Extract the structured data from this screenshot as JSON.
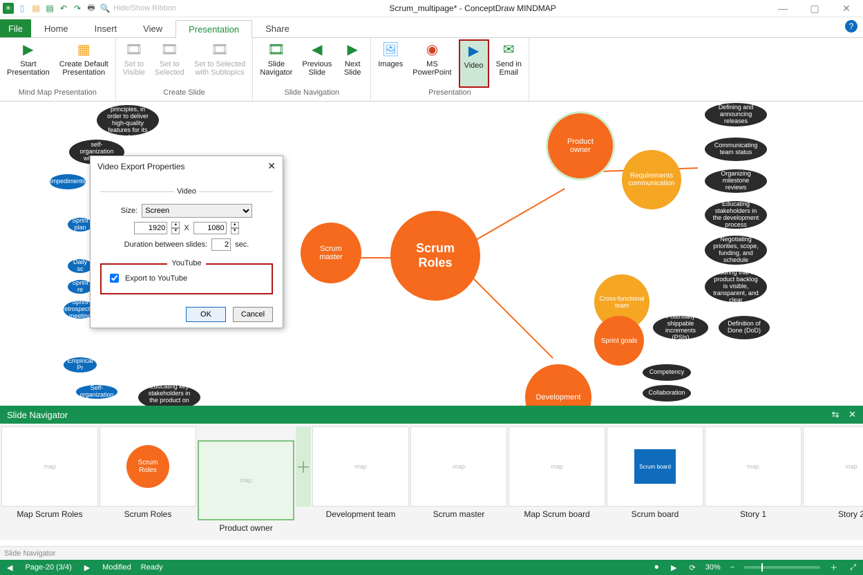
{
  "window": {
    "title": "Scrum_multipage* - ConceptDraw MINDMAP",
    "hide_ribbon": "Hide/Show Ribbon"
  },
  "tabs": {
    "file": "File",
    "home": "Home",
    "insert": "Insert",
    "view": "View",
    "presentation": "Presentation",
    "share": "Share"
  },
  "ribbon": {
    "group_mindmap": "Mind Map Presentation",
    "start_presentation": "Start\nPresentation",
    "create_default": "Create Default\nPresentation",
    "group_create": "Create Slide",
    "set_visible": "Set to\nVisible",
    "set_selected": "Set to\nSelected",
    "set_sel_sub": "Set to Selected\nwith Subtopics",
    "group_nav": "Slide Navigation",
    "slide_nav": "Slide\nNavigator",
    "prev_slide": "Previous\nSlide",
    "next_slide": "Next\nSlide",
    "images": "Images",
    "group_pres": "Presentation",
    "ms_ppt": "MS\nPowerPoint",
    "video": "Video",
    "send_email": "Send in\nEmail"
  },
  "canvas": {
    "center": "Scrum\nRoles",
    "scrum_master": "Scrum\nmaster",
    "product_owner": "Product\nowner",
    "req_comm": "Requirements\ncommunication",
    "cross_team": "Cross-functional\nteam",
    "sprint_goals": "Sprint goals",
    "development": "Development",
    "pills": {
      "p1": "Defining and announcing releases",
      "p2": "Communicating team status",
      "p3": "Organizing milestone reviews",
      "p4": "Educating stakeholders in the development process",
      "p5": "Negotiating priorities, scope, funding, and schedule",
      "p6": "Ensuring that the product backlog is visible, transparent, and clear",
      "p7": "Potentially shippable increments (PSIs)",
      "p8": "Definition of Done (DoD)",
      "p9": "Competency",
      "p10": "Collaboration",
      "l1": "Promoting self-organization within the team",
      "l2": "Impediments",
      "l3": "Sprint plan",
      "l4": "Daily sc",
      "l5": "Sprint re",
      "l6": "Sprint retrospective meeting",
      "l7": "Empirical Pr",
      "l8": "Self-organization",
      "l9": "Educating key stakeholders in the product on scrum",
      "top": "the scrum principles, in order to deliver high-quality features for its product"
    }
  },
  "dialog": {
    "title": "Video Export Properties",
    "video_legend": "Video",
    "size_label": "Size:",
    "size_value": "Screen",
    "width": "1920",
    "height": "1080",
    "x_sep": "X",
    "duration_label": "Duration between slides:",
    "duration": "2",
    "sec": "sec.",
    "yt_legend": "YouTube",
    "export_yt": "Export to YouTube",
    "ok": "OK",
    "cancel": "Cancel"
  },
  "slidenav": {
    "title": "Slide Navigator",
    "slides": [
      "Map Scrum Roles",
      "Scrum Roles",
      "Product owner",
      "Development team",
      "Scrum master",
      "Map Scrum board",
      "Scrum board",
      "Story 1",
      "Story 2"
    ],
    "bottom_label": "Slide Navigator"
  },
  "status": {
    "page": "Page-20 (3/4)",
    "modified": "Modified",
    "ready": "Ready",
    "zoom": "30%"
  },
  "chart_data": {
    "type": "mindmap",
    "central_node": "Scrum Roles",
    "branches": [
      {
        "name": "Scrum master",
        "children": [
          "Promoting self-organization within the team",
          "Impediments",
          "Sprint planning",
          "Daily scrum",
          "Sprint review",
          "Sprint retrospective meeting",
          "Empirical Process",
          "Self-organization",
          "Educating key stakeholders in the product on scrum",
          "the scrum principles, in order to deliver high-quality features for its product"
        ]
      },
      {
        "name": "Product owner",
        "children": [
          {
            "name": "Requirements communication",
            "children": [
              "Defining and announcing releases",
              "Communicating team status",
              "Organizing milestone reviews",
              "Educating stakeholders in the development process",
              "Negotiating priorities, scope, funding, and schedule",
              "Ensuring that the product backlog is visible, transparent, and clear"
            ]
          }
        ]
      },
      {
        "name": "Development",
        "children": [
          {
            "name": "Cross-functional team",
            "children": [
              "Competency",
              "Collaboration"
            ]
          },
          {
            "name": "Sprint goals",
            "children": [
              "Potentially shippable increments (PSIs)",
              "Definition of Done (DoD)"
            ]
          }
        ]
      }
    ]
  }
}
